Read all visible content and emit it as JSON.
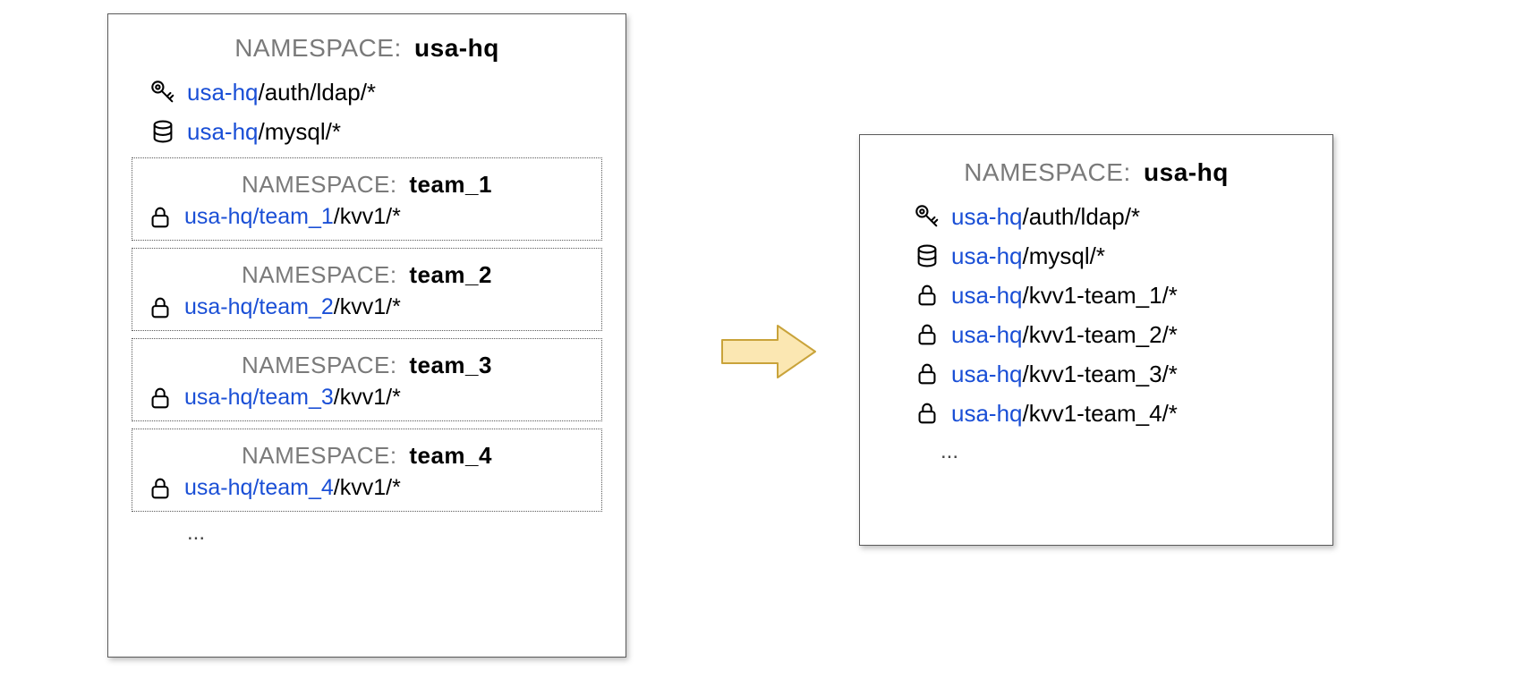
{
  "ns_label": "NAMESPACE:",
  "left": {
    "name": "usa-hq",
    "rows": [
      {
        "icon": "key",
        "link": "usa-hq",
        "rest": "/auth/ldap/*"
      },
      {
        "icon": "db",
        "link": "usa-hq",
        "rest": "/mysql/*"
      }
    ],
    "subs": [
      {
        "name": "team_1",
        "row": {
          "icon": "lock",
          "link": "usa-hq/team_1",
          "rest": "/kvv1/*"
        }
      },
      {
        "name": "team_2",
        "row": {
          "icon": "lock",
          "link": "usa-hq/team_2",
          "rest": "/kvv1/*"
        }
      },
      {
        "name": "team_3",
        "row": {
          "icon": "lock",
          "link": "usa-hq/team_3",
          "rest": "/kvv1/*"
        }
      },
      {
        "name": "team_4",
        "row": {
          "icon": "lock",
          "link": "usa-hq/team_4",
          "rest": "/kvv1/*"
        }
      }
    ],
    "ellipsis": "..."
  },
  "right": {
    "name": "usa-hq",
    "rows": [
      {
        "icon": "key",
        "link": "usa-hq",
        "rest": "/auth/ldap/*"
      },
      {
        "icon": "db",
        "link": "usa-hq",
        "rest": "/mysql/*"
      },
      {
        "icon": "lock",
        "link": "usa-hq",
        "rest": "/kvv1-team_1/*"
      },
      {
        "icon": "lock",
        "link": "usa-hq",
        "rest": "/kvv1-team_2/*"
      },
      {
        "icon": "lock",
        "link": "usa-hq",
        "rest": "/kvv1-team_3/*"
      },
      {
        "icon": "lock",
        "link": "usa-hq",
        "rest": "/kvv1-team_4/*"
      }
    ],
    "ellipsis": "..."
  }
}
